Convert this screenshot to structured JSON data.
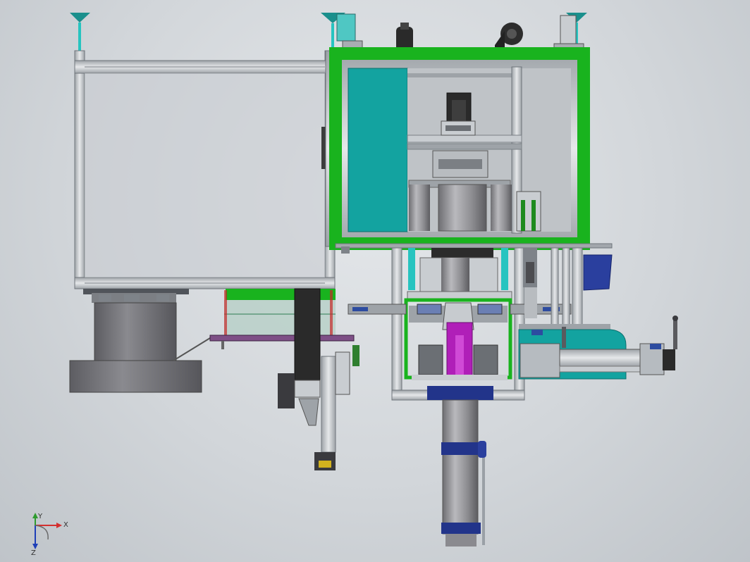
{
  "view": {
    "triad": {
      "x_label": "X",
      "y_label": "Y",
      "z_label": "Z"
    }
  },
  "colors": {
    "background": "#d2d6da",
    "frame_green": "#19b31e",
    "panel_teal": "#13a3a0",
    "profile_gray": "#c8ccd0",
    "dark_metal": "#3c3c3c",
    "magenta": "#b01fb8",
    "cylinder_gray": "#8f8f93",
    "navy": "#22348a",
    "slate_blue": "#5b6fa9"
  }
}
